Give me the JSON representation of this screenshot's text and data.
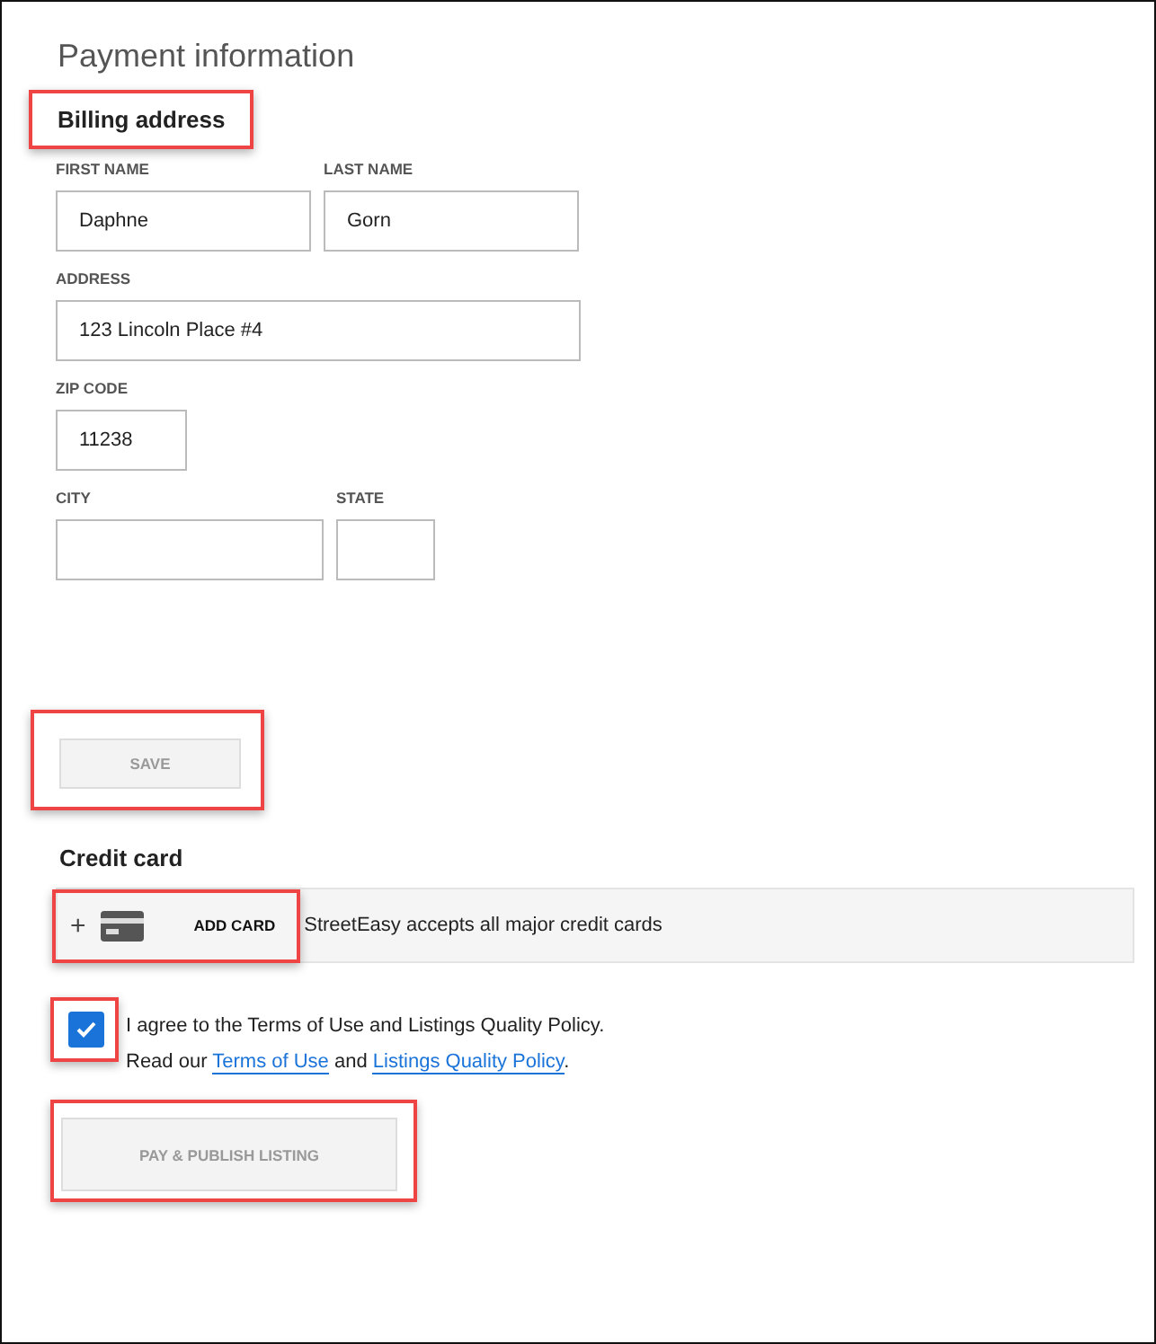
{
  "title": "Payment information",
  "billing": {
    "heading": "Billing address",
    "highlighted": true,
    "rows": [
      [
        {
          "label": "FIRST NAME",
          "value": "Daphne"
        },
        {
          "label": "LAST NAME",
          "value": "Gorn"
        }
      ],
      [
        {
          "label": "ADDRESS",
          "value": "123 Lincoln Place #4"
        }
      ],
      [
        {
          "label": "ZIP CODE",
          "value": "11238"
        }
      ],
      [
        {
          "label": "CITY"
        },
        {
          "label": "STATE"
        }
      ]
    ]
  },
  "save_button": {
    "label": "SAVE",
    "disabled": true,
    "highlighted": true
  },
  "credit_card": {
    "heading": "Credit card",
    "plus": "+",
    "add_label": "ADD CARD",
    "highlighted": true,
    "note": "StreetEasy accepts all major credit cards"
  },
  "agreement": {
    "checked": true,
    "highlighted": true,
    "text": "I agree to the Terms of Use and Listings Quality Policy.",
    "read_line": [
      {
        "kind": "text",
        "text": "Read our"
      },
      {
        "kind": "link",
        "text": "Terms of Use"
      },
      {
        "kind": "text",
        "text": "and"
      },
      {
        "kind": "link",
        "text": "Listings Quality Policy"
      },
      {
        "kind": "text",
        "text": "."
      }
    ]
  },
  "publish_button": {
    "label": "PAY & PUBLISH LISTING",
    "disabled": true,
    "highlighted": true
  }
}
